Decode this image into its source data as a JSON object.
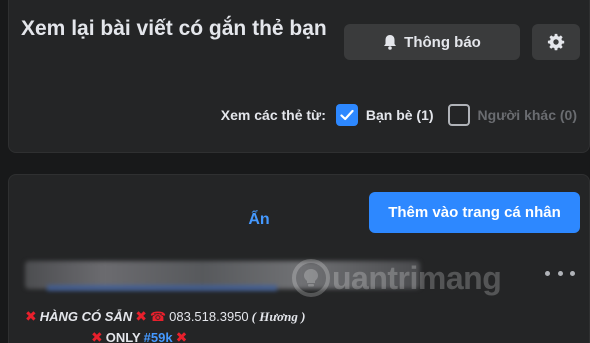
{
  "header": {
    "title": "Xem lại bài viết có gắn thẻ bạn",
    "notify_label": "Thông báo"
  },
  "filter": {
    "label": "Xem các thẻ từ:",
    "options": [
      {
        "label": "Bạn bè (1)",
        "checked": true
      },
      {
        "label": "Người khác (0)",
        "checked": false
      }
    ]
  },
  "actions": {
    "hide_label": "Ẩn",
    "add_label": "Thêm vào trang cá nhân"
  },
  "post": {
    "shop_text": "HÀNG CÓ SẴN",
    "phone": "083.518.3950",
    "name": "( Hương )",
    "only_text": "ONLY",
    "hashtag": "#59k"
  },
  "watermark": {
    "text": "uantrimang"
  },
  "colors": {
    "background": "#18191a",
    "card": "#242526",
    "button": "#3a3b3c",
    "accent": "#2d88ff",
    "link": "#4599ff",
    "red_x": "#e8202c"
  },
  "icons": [
    "bell-icon",
    "gear-icon",
    "check-icon",
    "more-icon",
    "cross-mark-icon",
    "telephone-icon"
  ]
}
